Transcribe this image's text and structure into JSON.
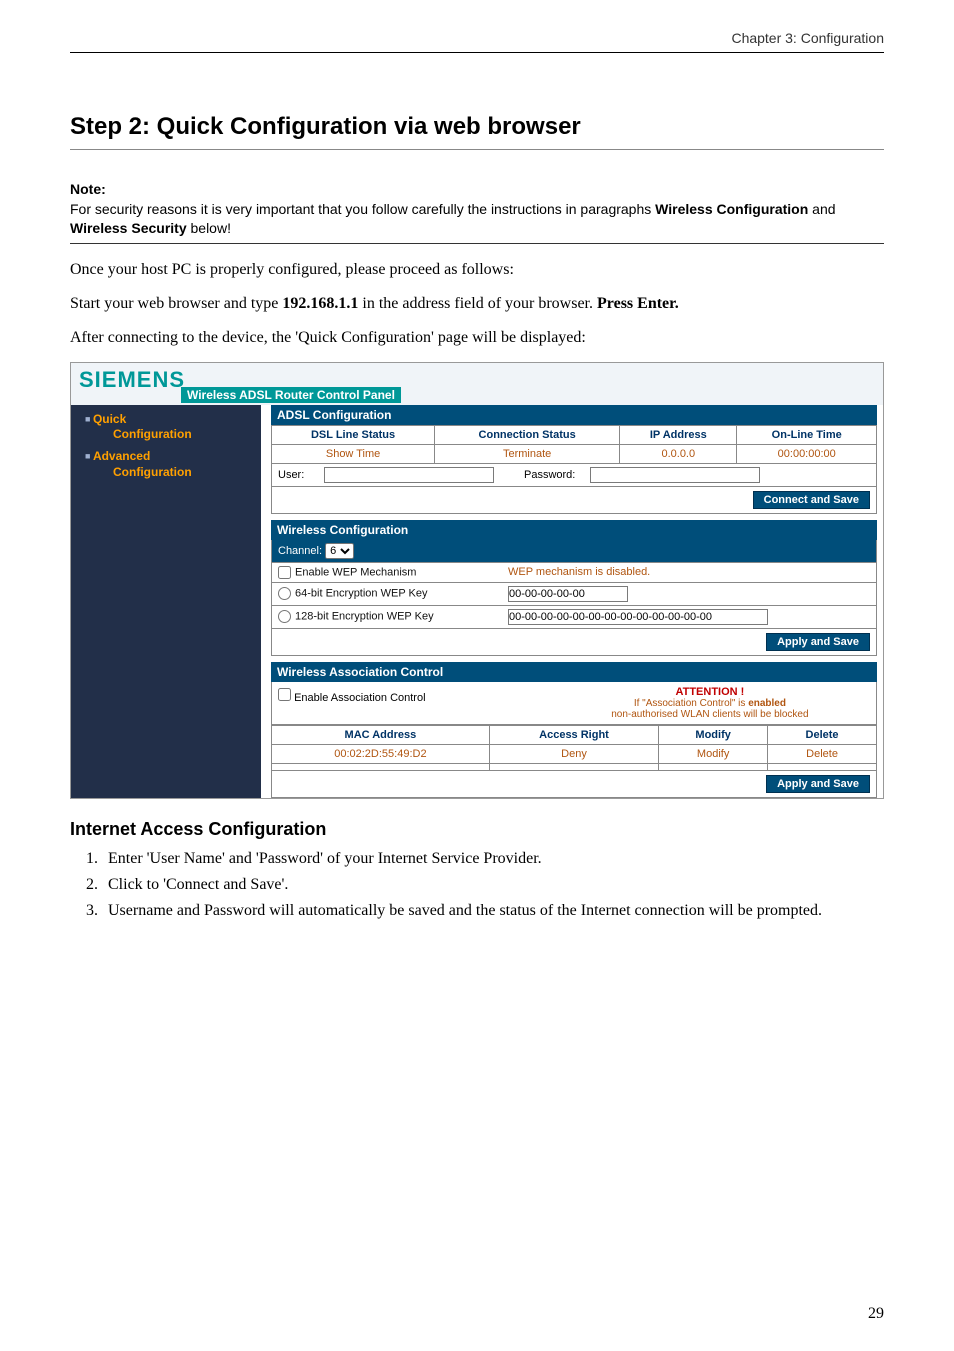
{
  "chapter": "Chapter 3: Configuration",
  "step_title": "Step 2: Quick Configuration via web browser",
  "note": {
    "label": "Note:",
    "line1": "For security reasons it is very important that you follow carefully the instructions in paragraphs ",
    "bold1": "Wireless Configuration",
    "mid": " and ",
    "bold2": "Wireless Security",
    "tail": " below!"
  },
  "para1_a": "Once your host PC is properly configured, please proceed as follows:",
  "para2_a": "Start your web browser and type ",
  "para2_b": "192.168.1.1",
  "para2_c": " in the address field of your browser. ",
  "para2_d": "Press Enter.",
  "para3": "After connecting to the device, the 'Quick Configuration' page will be displayed:",
  "shot": {
    "logo": "SIEMENS",
    "subtitle": "Wireless ADSL Router  Control Panel",
    "nav": {
      "quick_top": "Quick",
      "quick_sub": "Configuration",
      "adv_top": "Advanced",
      "adv_sub": "Configuration"
    },
    "adsl": {
      "bar": "ADSL Configuration",
      "h1": "DSL Line Status",
      "h2": "Connection Status",
      "h3": "IP Address",
      "h4": "On-Line Time",
      "v1": "Show Time",
      "v2": "Terminate",
      "v3": "0.0.0.0",
      "v4": "00:00:00:00",
      "user_lbl": "User:",
      "pass_lbl": "Password:",
      "btn": "Connect and Save"
    },
    "wcfg": {
      "bar": "Wireless Configuration",
      "channel_lbl": "Channel:",
      "channel_val": "6",
      "enable_wep": "Enable WEP Mechanism",
      "wep_status": "WEP mechanism is disabled.",
      "k64": "64-bit Encryption WEP Key",
      "k64_val": "00-00-00-00-00",
      "k128": "128-bit Encryption WEP Key",
      "k128_val": "00-00-00-00-00-00-00-00-00-00-00-00-00",
      "btn": "Apply and Save"
    },
    "wassoc": {
      "bar": "Wireless Association Control",
      "enable": "Enable Association Control",
      "attn": "ATTENTION !",
      "attn2a": "If \"Association Control\" is ",
      "attn2b": "enabled",
      "attn2c": "non-authorised WLAN clients will be blocked",
      "h1": "MAC Address",
      "h2": "Access Right",
      "h3": "Modify",
      "h4": "Delete",
      "v1": "00:02:2D:55:49:D2",
      "v2": "Deny",
      "v3": "Modify",
      "v4": "Delete",
      "btn": "Apply and Save"
    }
  },
  "section2": "Internet Access Configuration",
  "steps": [
    "Enter 'User Name' and 'Password' of your Internet Service Provider.",
    "Click to 'Connect and Save'.",
    "Username and Password will automatically be saved and the status of the Internet connection will be prompted."
  ],
  "pagenum": "29"
}
